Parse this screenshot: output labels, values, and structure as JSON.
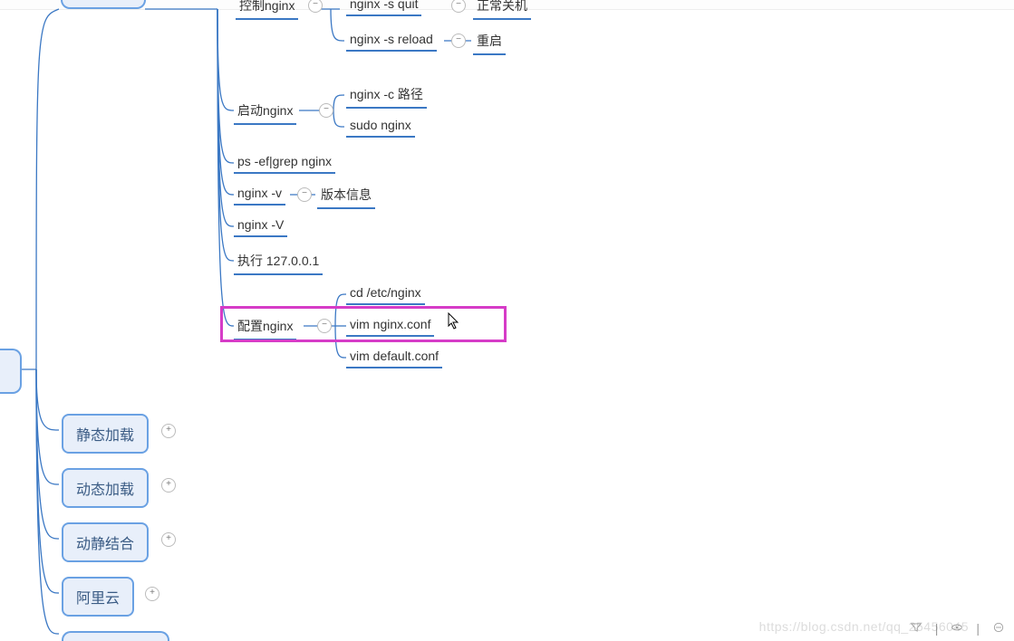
{
  "nodes": {
    "control_nginx_label": "控制nginx",
    "nginx_quit": "nginx -s quit",
    "normal_shutdown": "正常关机",
    "nginx_reload": "nginx -s reload",
    "restart": "重启",
    "start_nginx": "启动nginx",
    "nginx_c_path": "nginx -c 路径",
    "sudo_nginx": "sudo nginx",
    "ps_grep_nginx": "ps -ef|grep nginx",
    "nginx_v": "nginx -v",
    "version_info": "版本信息",
    "nginx_V": "nginx -V",
    "exec_local": "执行  127.0.0.1",
    "config_nginx": "配置nginx",
    "cd_etc_nginx": "cd /etc/nginx",
    "vim_nginx_conf": "vim nginx.conf",
    "vim_default_conf": "vim default.conf",
    "static_load": "静态加载",
    "dynamic_load": "动态加载",
    "static_dynamic": "动静结合",
    "aliyun": "阿里云"
  },
  "watermark": "https://blog.csdn.net/qq_25456045",
  "toggles": {
    "minus": "−",
    "plus": "+"
  }
}
